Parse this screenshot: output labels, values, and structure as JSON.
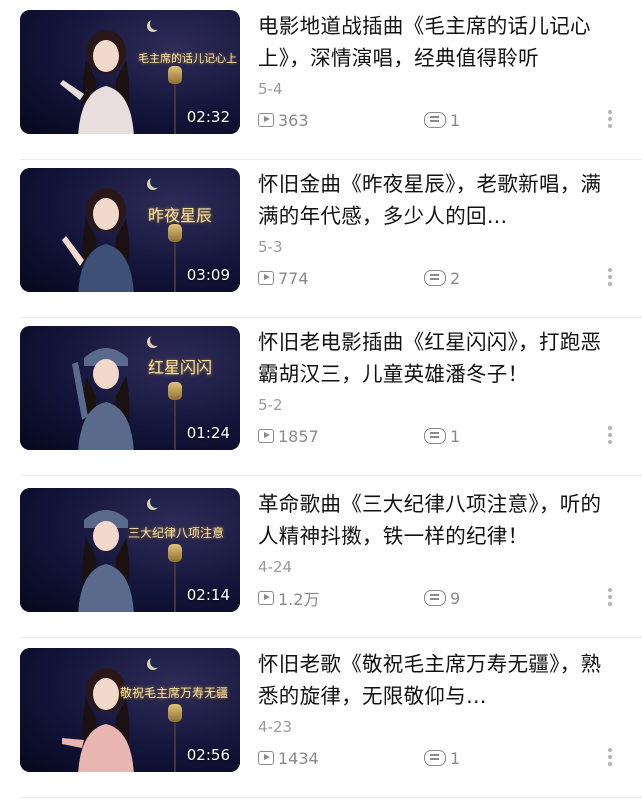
{
  "videos": [
    {
      "title": "电影地道战插曲《毛主席的话儿记心上》，深情演唱，经典值得聆听",
      "thumb_text": "毛主席的话儿记心上",
      "duration": "02:32",
      "date": "5-4",
      "views": "363",
      "comments": "1"
    },
    {
      "title": "怀旧金曲《昨夜星辰》，老歌新唱，满满的年代感，多少人的回…",
      "thumb_text": "昨夜星辰",
      "duration": "03:09",
      "date": "5-3",
      "views": "774",
      "comments": "2"
    },
    {
      "title": "怀旧老电影插曲《红星闪闪》，打跑恶霸胡汉三，儿童英雄潘冬子！",
      "thumb_text": "红星闪闪",
      "duration": "01:24",
      "date": "5-2",
      "views": "1857",
      "comments": "1"
    },
    {
      "title": "革命歌曲《三大纪律八项注意》，听的人精神抖擞，铁一样的纪律！",
      "thumb_text": "三大纪律八项注意",
      "duration": "02:14",
      "date": "4-24",
      "views": "1.2万",
      "comments": "9"
    },
    {
      "title": "怀旧老歌《敬祝毛主席万寿无疆》，熟悉的旋律，无限敬仰与…",
      "thumb_text": "敬祝毛主席万寿无疆",
      "duration": "02:56",
      "date": "4-23",
      "views": "1434",
      "comments": "1"
    }
  ]
}
